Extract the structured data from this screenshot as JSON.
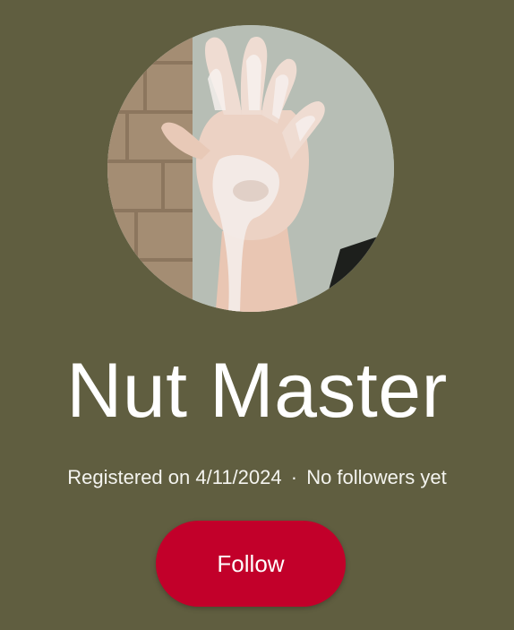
{
  "profile": {
    "display_name": "Nut Master",
    "registered_label": "Registered on 4/11/2024",
    "separator": "·",
    "followers_label": "No followers yet",
    "follow_button": "Follow",
    "avatar_icon": "profile-photo-hand"
  },
  "colors": {
    "background": "#605e40",
    "follow_button": "#c2002a",
    "text": "#ffffff"
  }
}
